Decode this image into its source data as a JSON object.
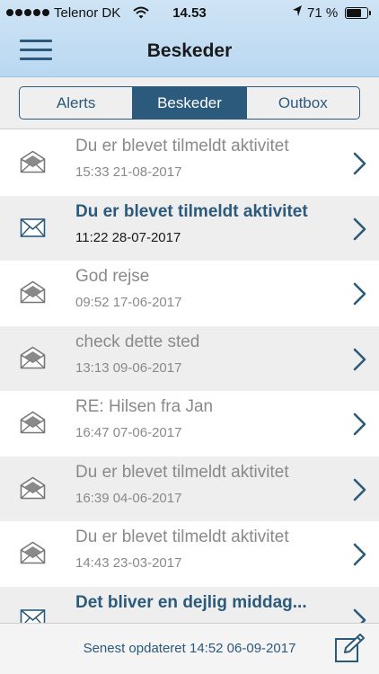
{
  "status_bar": {
    "carrier": "Telenor DK",
    "time": "14.53",
    "battery_percent": "71 %",
    "battery_level": 0.71,
    "icons": [
      "signal-dots-icon",
      "wifi-icon",
      "location-arrow-icon",
      "battery-icon"
    ]
  },
  "header": {
    "title": "Beskeder",
    "menu_icon": "hamburger-menu-icon"
  },
  "tabs": [
    {
      "label": "Alerts",
      "active": false
    },
    {
      "label": "Beskeder",
      "active": true
    },
    {
      "label": "Outbox",
      "active": false
    }
  ],
  "messages": [
    {
      "subject": "Du er blevet tilmeldt aktivitet",
      "date": "15:33 21-08-2017",
      "unread": false,
      "icon": "envelope-open-icon"
    },
    {
      "subject": "Du er blevet tilmeldt aktivitet",
      "date": "11:22 28-07-2017",
      "unread": true,
      "icon": "envelope-closed-icon"
    },
    {
      "subject": "God rejse",
      "date": "09:52 17-06-2017",
      "unread": false,
      "icon": "envelope-open-icon"
    },
    {
      "subject": "check dette sted",
      "date": "13:13 09-06-2017",
      "unread": false,
      "icon": "envelope-open-icon"
    },
    {
      "subject": "RE: Hilsen fra Jan",
      "date": "16:47 07-06-2017",
      "unread": false,
      "icon": "envelope-open-icon"
    },
    {
      "subject": "Du er blevet tilmeldt aktivitet",
      "date": "16:39 04-06-2017",
      "unread": false,
      "icon": "envelope-open-icon"
    },
    {
      "subject": "Du er blevet tilmeldt aktivitet",
      "date": "14:43 23-03-2017",
      "unread": false,
      "icon": "envelope-open-icon"
    },
    {
      "subject": "Det bliver en dejlig middag...",
      "date": "",
      "unread": true,
      "icon": "envelope-closed-icon"
    }
  ],
  "footer": {
    "updated_text": "Senest opdateret 14:52 06-09-2017",
    "compose_icon": "compose-icon"
  },
  "colors": {
    "accent": "#2c5a7c",
    "header_bg": "#c4def3",
    "read_text": "#8a8a8a",
    "alt_row_bg": "#eeeeee"
  }
}
